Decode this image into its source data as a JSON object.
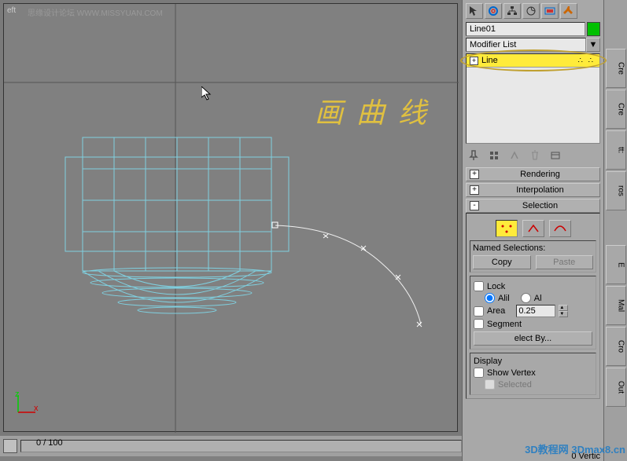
{
  "viewport": {
    "label": "eft",
    "watermark": "思缘设计论坛 WWW.MISSYUAN.COM"
  },
  "annotation": "画 曲 线",
  "timeline": {
    "label": "0 / 100"
  },
  "object": {
    "name": "Line01",
    "color": "#00c000"
  },
  "modifier_list": {
    "label": "Modifier List"
  },
  "stack": {
    "item": "Line"
  },
  "rollouts": {
    "rendering": "Rendering",
    "interpolation": "Interpolation",
    "selection": {
      "title": "Selection",
      "named_label": "Named Selections:",
      "copy": "Copy",
      "paste": "Paste",
      "lock": "Lock",
      "alil": "Alil",
      "al": "Al",
      "area": "Area",
      "area_val": "0.25",
      "segment": "Segment",
      "select_by": "elect By...",
      "display": "Display",
      "show_vertex": "Show Vertex",
      "selected": "Selected"
    }
  },
  "status": "0 Vertic",
  "side_tabs": [
    "Cre",
    "Cre",
    "tt:",
    "ros"
  ],
  "side_tabs2": [
    "E",
    "Mal",
    "Cro",
    "Out"
  ],
  "watermark_br": "3D教程网 3Dmax8.cn"
}
